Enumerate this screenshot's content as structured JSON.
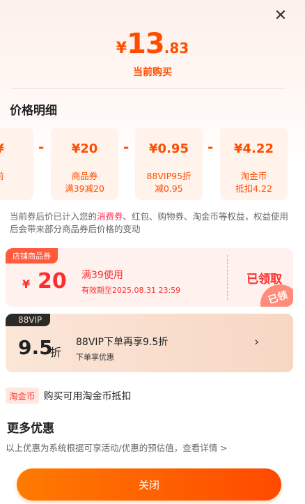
{
  "header": {
    "close_glyph": "✕",
    "price_symbol": "¥",
    "price_int": "13",
    "price_dec": ".83",
    "price_label": "当前购买"
  },
  "breakdown": {
    "title": "价格明细",
    "partial_card": {
      "amount": "¥",
      "line1": "",
      "line2": "前"
    },
    "cards": [
      {
        "amount": "¥20",
        "line1": "商品券",
        "line2": "满39减20"
      },
      {
        "amount": "¥0.95",
        "line1": "88VIP95折",
        "line2": "减0.95"
      },
      {
        "amount": "¥4.22",
        "line1": "淘金币",
        "line2": "抵扣4.22"
      }
    ],
    "operator": "-"
  },
  "note": {
    "before": "当前券后价已计入您的",
    "highlight": "消费券",
    "after": "、红包、购物券、淘金币等权益，权益使用后会带来部分商品券后价格的变动"
  },
  "coupon": {
    "tag": "店铺商品券",
    "currency": "¥",
    "amount": "20",
    "condition": "满39使用",
    "expiry": "有效期至2025.08.31 23:59",
    "status": "已领取",
    "stamp": "已领"
  },
  "vip": {
    "tag": "88VIP",
    "rate": "9.5",
    "rate_unit": "折",
    "title": "88VIP下单再享9.5折",
    "subtitle": "下单享优惠",
    "chevron": "›"
  },
  "coin": {
    "badge": "淘金币",
    "text": "购买可用淘金币抵扣"
  },
  "more": {
    "title": "更多优惠",
    "desc": "以上优惠为系统根据可享活动/优惠的预估值，查看详情 >"
  },
  "footer": {
    "close_label": "关闭"
  }
}
